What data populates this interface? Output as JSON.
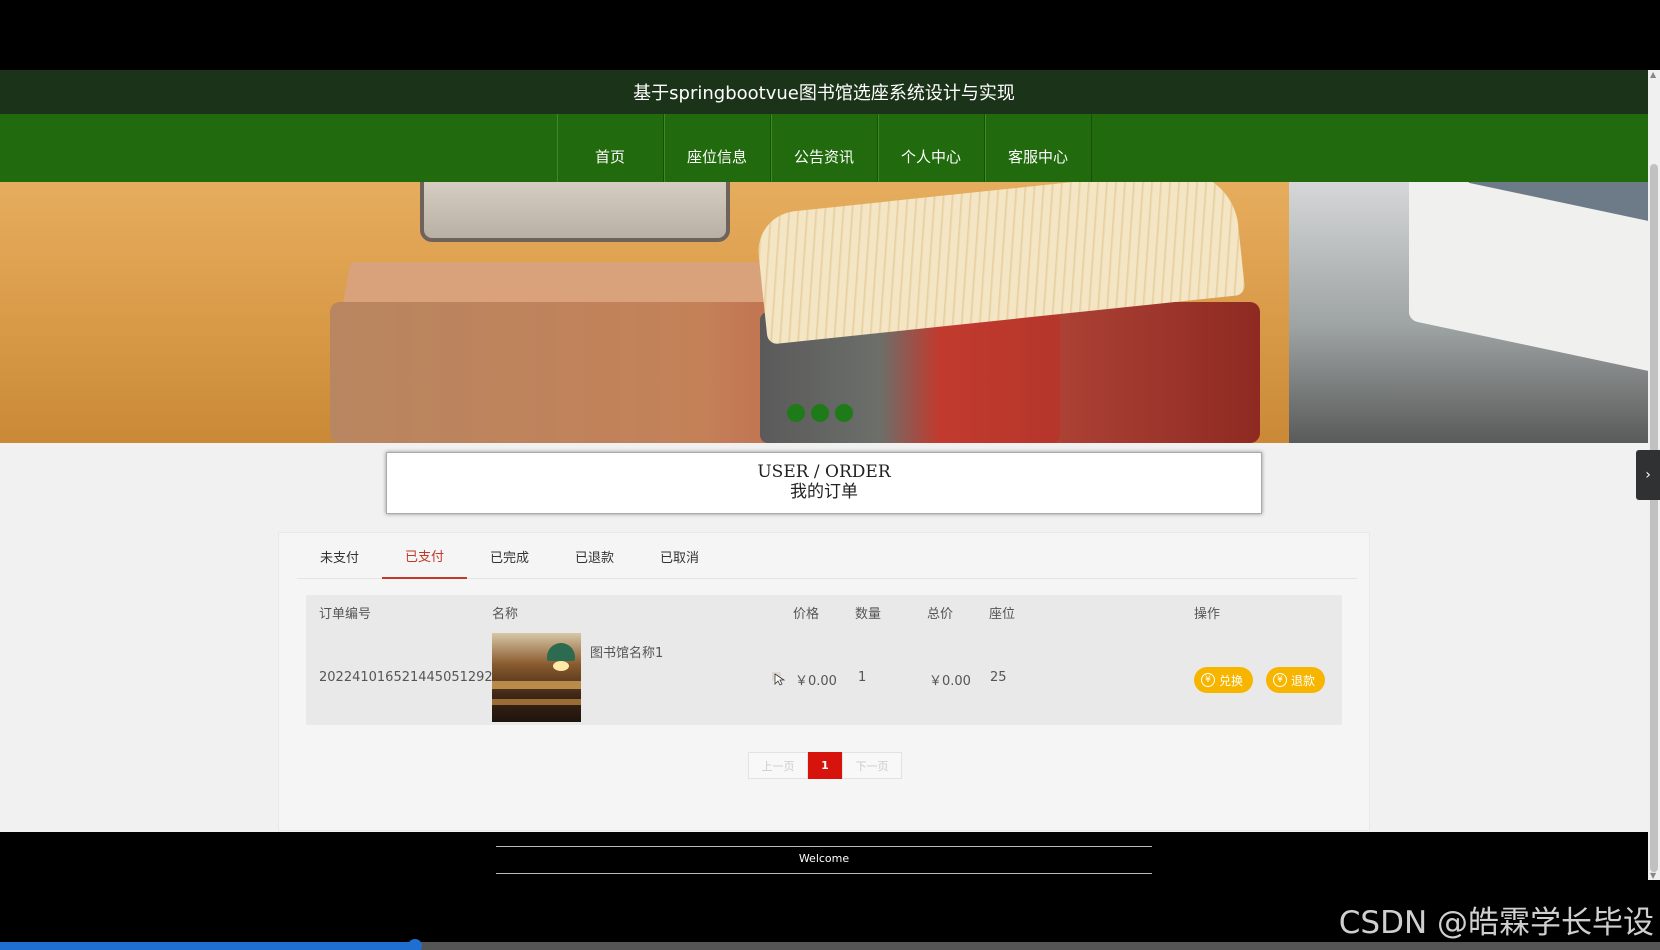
{
  "header": {
    "title": "基于springbootvue图书馆选座系统设计与实现"
  },
  "nav": {
    "items": [
      "首页",
      "座位信息",
      "公告资讯",
      "个人中心",
      "客服中心"
    ]
  },
  "section": {
    "title_en": "USER / ORDER",
    "title_cn": "我的订单"
  },
  "tabs": {
    "items": [
      "未支付",
      "已支付",
      "已完成",
      "已退款",
      "已取消"
    ],
    "active": "已支付"
  },
  "table": {
    "headers": [
      "订单编号",
      "名称",
      "价格",
      "数量",
      "总价",
      "座位",
      "操作"
    ],
    "rows": [
      {
        "order_no": "202241016521445051292",
        "name": "图书馆名称1",
        "price": "￥0.00",
        "quantity": "1",
        "total": "￥0.00",
        "seat": "25",
        "actions": [
          "兑换",
          "退款"
        ]
      }
    ]
  },
  "pagination": {
    "prev": "上一页",
    "current": "1",
    "next": "下一页"
  },
  "footer": {
    "welcome": "Welcome"
  },
  "watermark": "CSDN @皓霖学长毕设",
  "banner": {
    "slide_count": 3
  },
  "video_progress": {
    "played_fraction": 0.25
  },
  "colors": {
    "nav": "#216a0d",
    "title_bar": "#1b3419",
    "accent": "#c0392b",
    "button": "#f7b500",
    "page_active": "#d6130d"
  },
  "icons": {
    "coin": "coin-icon",
    "side_toggle": "chevron-right-icon",
    "cursor": "cursor-icon"
  }
}
